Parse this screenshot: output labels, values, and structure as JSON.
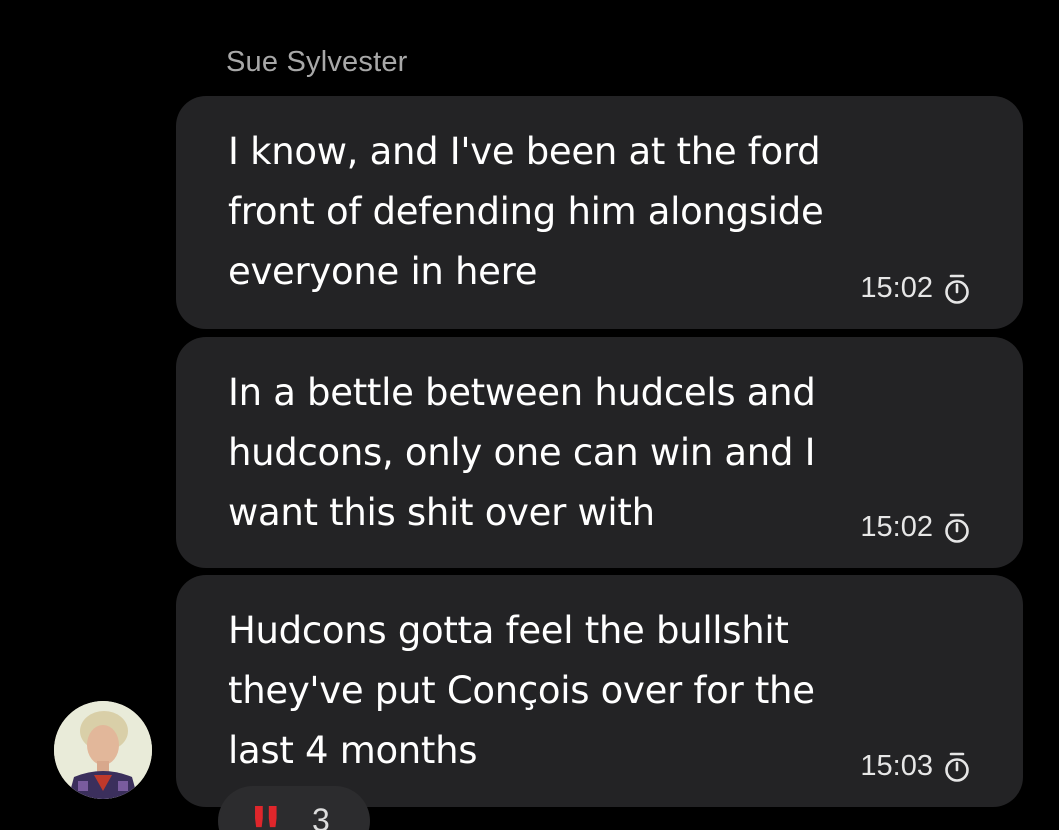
{
  "chat": {
    "sender_name": "Sue Sylvester",
    "messages": [
      {
        "text": "I know, and I've been at the ford\nfront of defending him alongside\neveryone in here",
        "time": "15:02",
        "status_icon": "timer-icon"
      },
      {
        "text": "In a bettle between hudcels and\nhudcons, only one can win and I\nwant this shit over with",
        "time": "15:02",
        "status_icon": "timer-icon"
      },
      {
        "text": "Hudcons gotta feel the bullshit\nthey've put Conçois over for the\nlast 4 months",
        "time": "15:03",
        "status_icon": "timer-icon"
      }
    ],
    "reaction": {
      "emoji": "‼",
      "count": "3"
    }
  },
  "colors": {
    "background": "#000000",
    "bubble": "#232325",
    "sender_name": "#a8a8a8",
    "message_text": "#ffffff",
    "reaction_emoji": "#e0262b"
  }
}
